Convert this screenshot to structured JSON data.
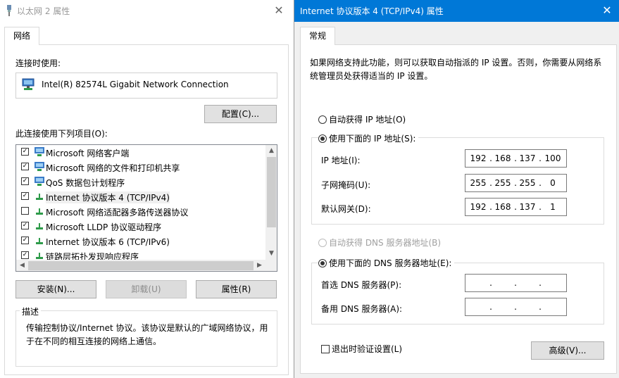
{
  "left_window": {
    "title": "以太网 2 属性",
    "tab": "网络",
    "connect_using_label": "连接时使用:",
    "adapter_name": "Intel(R) 82574L Gigabit Network Connection",
    "configure_button": "配置(C)...",
    "items_label": "此连接使用下列项目(O):",
    "items": [
      {
        "label": "Microsoft 网络客户端",
        "checked": true,
        "icon": "network-client-icon"
      },
      {
        "label": "Microsoft 网络的文件和打印机共享",
        "checked": true,
        "icon": "file-sharing-icon"
      },
      {
        "label": "QoS 数据包计划程序",
        "checked": true,
        "icon": "qos-icon"
      },
      {
        "label": "Internet 协议版本 4 (TCP/IPv4)",
        "checked": true,
        "icon": "protocol-icon",
        "selected": true
      },
      {
        "label": "Microsoft 网络适配器多路传送器协议",
        "checked": false,
        "icon": "protocol-icon"
      },
      {
        "label": "Microsoft LLDP 协议驱动程序",
        "checked": true,
        "icon": "protocol-icon"
      },
      {
        "label": "Internet 协议版本 6 (TCP/IPv6)",
        "checked": true,
        "icon": "protocol-icon"
      },
      {
        "label": "链路层拓扑发现响应程序",
        "checked": true,
        "icon": "protocol-icon"
      }
    ],
    "install_button": "安装(N)...",
    "uninstall_button": "卸载(U)",
    "properties_button": "属性(R)",
    "description_title": "描述",
    "description_text": "传输控制协议/Internet 协议。该协议是默认的广域网络协议，用于在不同的相互连接的网络上通信。"
  },
  "right_window": {
    "title": "Internet 协议版本 4 (TCP/IPv4) 属性",
    "tab": "常规",
    "intro": "如果网络支持此功能，则可以获取自动指派的 IP 设置。否则，你需要从网络系统管理员处获得适当的 IP 设置。",
    "ip_auto_label": "自动获得 IP 地址(O)",
    "ip_manual_label": "使用下面的 IP 地址(S):",
    "ip_mode": "manual",
    "ip_address_label": "IP 地址(I):",
    "ip_address": [
      "192",
      "168",
      "137",
      "100"
    ],
    "subnet_label": "子网掩码(U):",
    "subnet": [
      "255",
      "255",
      "255",
      "0"
    ],
    "gateway_label": "默认网关(D):",
    "gateway": [
      "192",
      "168",
      "137",
      "1"
    ],
    "dns_auto_label": "自动获得 DNS 服务器地址(B)",
    "dns_manual_label": "使用下面的 DNS 服务器地址(E):",
    "dns_mode": "manual",
    "preferred_dns_label": "首选 DNS 服务器(P):",
    "preferred_dns": [
      "",
      "",
      "",
      ""
    ],
    "alternate_dns_label": "备用 DNS 服务器(A):",
    "alternate_dns": [
      "",
      "",
      "",
      ""
    ],
    "validate_label": "退出时验证设置(L)",
    "validate_checked": false,
    "advanced_button": "高级(V)..."
  },
  "colors": {
    "titlebar_active": "#0078d7",
    "button_face": "#e1e1e1",
    "window_bg": "#f0f0f0"
  }
}
